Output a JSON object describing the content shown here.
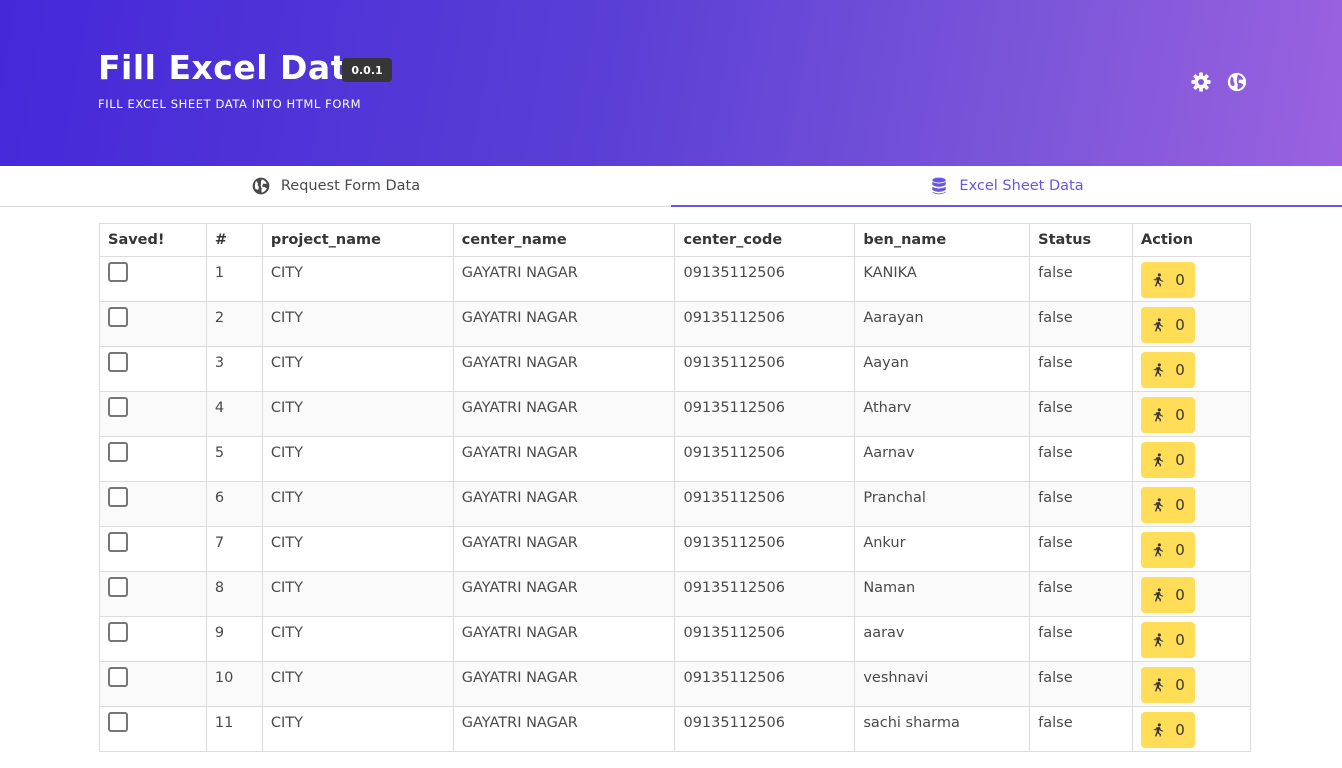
{
  "header": {
    "title": "Fill Excel Data",
    "version": "0.0.1",
    "subtitle": "FILL EXCEL SHEET DATA INTO HTML FORM"
  },
  "icons": {
    "settings": "gear-icon",
    "language": "globe-icon",
    "tab_request": "globe-icon",
    "tab_excel": "database-icon",
    "action": "running-person-icon"
  },
  "colors": {
    "hero_start": "#4528d8",
    "hero_end": "#9a62e0",
    "active_tab": "#6a55e0",
    "action_button": "#ffdd57",
    "version_tag": "#363636"
  },
  "tabs": [
    {
      "label": "Request Form Data",
      "active": false
    },
    {
      "label": "Excel Sheet Data",
      "active": true
    }
  ],
  "table": {
    "headers": [
      "Saved!",
      "#",
      "project_name",
      "center_name",
      "center_code",
      "ben_name",
      "Status",
      "Action"
    ],
    "rows": [
      {
        "num": "1",
        "project": "CITY",
        "center": "GAYATRI NAGAR",
        "code": "09135112506",
        "ben": "KANIKA",
        "status": "false",
        "action": "0"
      },
      {
        "num": "2",
        "project": "CITY",
        "center": "GAYATRI NAGAR",
        "code": "09135112506",
        "ben": "Aarayan",
        "status": "false",
        "action": "0"
      },
      {
        "num": "3",
        "project": "CITY",
        "center": "GAYATRI NAGAR",
        "code": "09135112506",
        "ben": "Aayan",
        "status": "false",
        "action": "0"
      },
      {
        "num": "4",
        "project": "CITY",
        "center": "GAYATRI NAGAR",
        "code": "09135112506",
        "ben": "Atharv",
        "status": "false",
        "action": "0"
      },
      {
        "num": "5",
        "project": "CITY",
        "center": "GAYATRI NAGAR",
        "code": "09135112506",
        "ben": "Aarnav",
        "status": "false",
        "action": "0"
      },
      {
        "num": "6",
        "project": "CITY",
        "center": "GAYATRI NAGAR",
        "code": "09135112506",
        "ben": "Pranchal",
        "status": "false",
        "action": "0"
      },
      {
        "num": "7",
        "project": "CITY",
        "center": "GAYATRI NAGAR",
        "code": "09135112506",
        "ben": "Ankur",
        "status": "false",
        "action": "0"
      },
      {
        "num": "8",
        "project": "CITY",
        "center": "GAYATRI NAGAR",
        "code": "09135112506",
        "ben": "Naman",
        "status": "false",
        "action": "0"
      },
      {
        "num": "9",
        "project": "CITY",
        "center": "GAYATRI NAGAR",
        "code": "09135112506",
        "ben": "aarav",
        "status": "false",
        "action": "0"
      },
      {
        "num": "10",
        "project": "CITY",
        "center": "GAYATRI NAGAR",
        "code": "09135112506",
        "ben": "veshnavi",
        "status": "false",
        "action": "0"
      },
      {
        "num": "11",
        "project": "CITY",
        "center": "GAYATRI NAGAR",
        "code": "09135112506",
        "ben": "sachi sharma",
        "status": "false",
        "action": "0"
      }
    ]
  }
}
